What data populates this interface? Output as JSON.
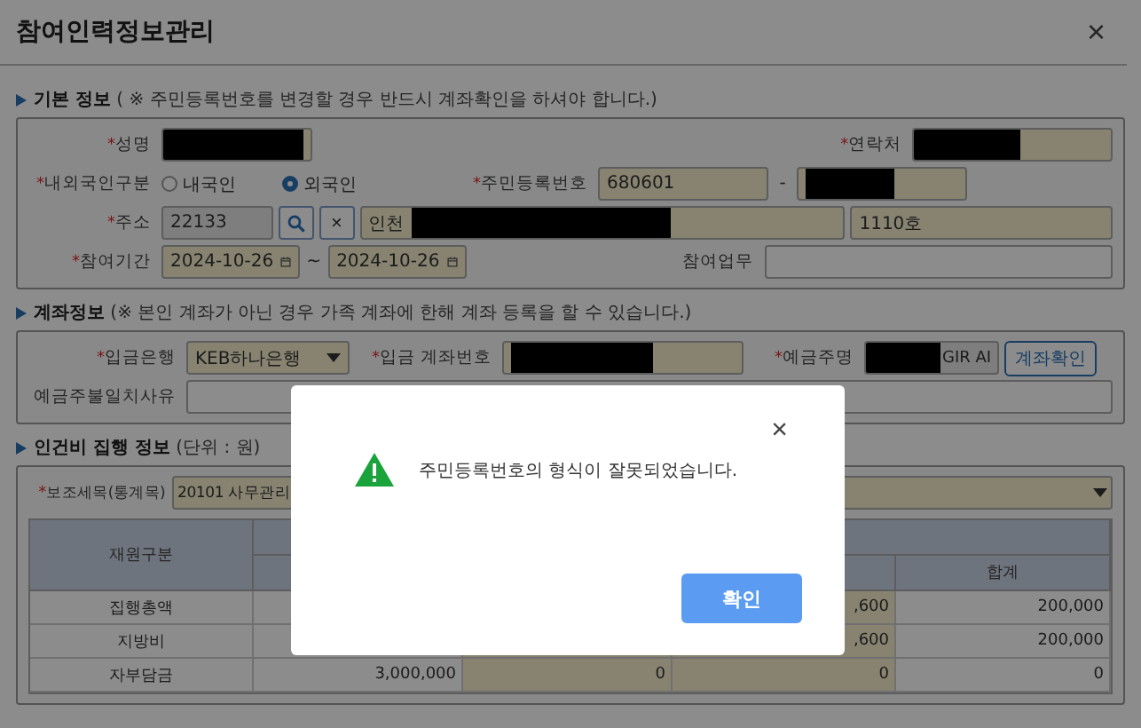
{
  "window": {
    "title": "참여인력정보관리",
    "close": "×"
  },
  "basic": {
    "heading": "**기본 정보** ( ※ 주민등록번호를 변경할 경우 반드시 계좌확인을 하셔야 합니다.)",
    "name": {
      "label": "성명",
      "mark": "*"
    },
    "contact": {
      "label": "연락처",
      "mark": "*"
    },
    "nationality": {
      "label": "내외국인구분",
      "mark": "*",
      "options": [
        {
          "label": "내국인",
          "selected": false
        },
        {
          "label": "외국인",
          "selected": true
        }
      ]
    },
    "resident_no": {
      "label": "주민등록번호",
      "mark": "*",
      "value": "680601",
      "separator": "-"
    },
    "address": {
      "label": "주소",
      "mark": "*",
      "postcode": "22133",
      "clear": "×",
      "street": "인천",
      "detail": "1110호"
    },
    "period": {
      "label": "참여기간",
      "mark": "*",
      "start": "2024-10-26",
      "separator": "~",
      "end": "2024-10-26"
    },
    "duty": {
      "label": "참여업무"
    }
  },
  "account": {
    "heading": "**계좌정보** (※ 본인 계좌가 아닌 경우 가족 계좌에 한해 계좌 등록을 할 수 있습니다.)",
    "bank": {
      "label": "입금은행",
      "mark": "*",
      "value": "KEB하나은행"
    },
    "account_no": {
      "label": "입금 계좌번호",
      "mark": "*"
    },
    "holder": {
      "label": "예금주명",
      "mark": "*",
      "value": "GIR AI"
    },
    "check_button": "계좌확인",
    "mismatch": {
      "label": "예금주불일치사유"
    }
  },
  "expense": {
    "heading": "**인건비 집행 정보** (단위 : 원)",
    "item": {
      "label": "보조세목(통계목)",
      "mark": "*",
      "value": "20101 사무관리"
    },
    "table": {
      "columns": [
        "재원구분",
        "합계"
      ],
      "rows": [
        {
          "label": "집행총액",
          "column_4": ",600",
          "total": "200,000"
        },
        {
          "label": "지방비",
          "column_4": ",600",
          "total": "200,000"
        },
        {
          "label": "자부담금",
          "column_2": "3,000,000",
          "column_3": "0",
          "column_4": "0",
          "total": "0"
        }
      ]
    }
  },
  "alert": {
    "close": "×",
    "message": "주민등록번호의 형식이 잘못되었습니다.",
    "button": "확인"
  }
}
